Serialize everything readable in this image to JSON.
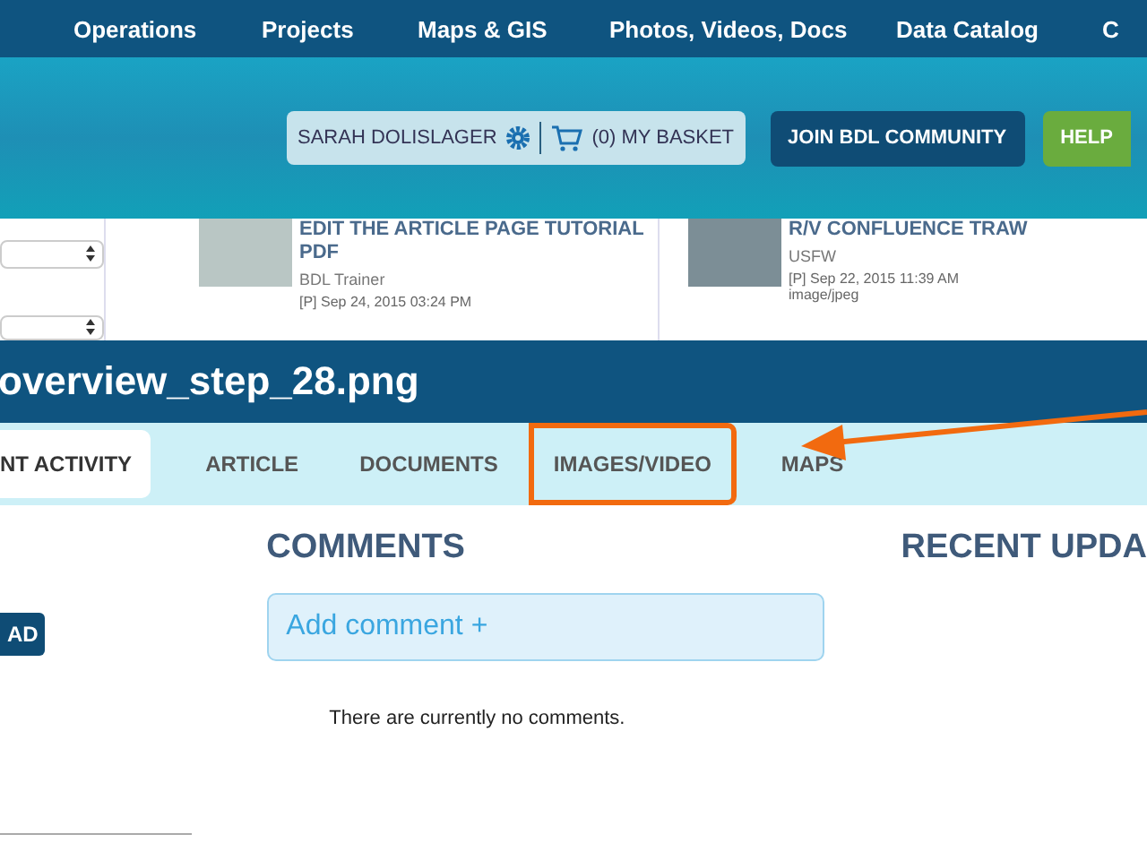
{
  "top_nav": {
    "items": [
      {
        "label": "Operations"
      },
      {
        "label": "Projects"
      },
      {
        "label": "Maps & GIS"
      },
      {
        "label": "Photos, Videos, Docs"
      },
      {
        "label": "Data Catalog"
      },
      {
        "label": "C"
      }
    ]
  },
  "user_bar": {
    "user_name": "SARAH DOLISLAGER",
    "basket": "(0) MY BASKET"
  },
  "header_buttons": [
    {
      "label": "JOIN BDL COMMUNITY",
      "kind": "primary"
    },
    {
      "label": "HELP",
      "kind": "help"
    }
  ],
  "recent_cards": [
    {
      "title": "EDIT THE ARTICLE PAGE TUTORIAL PDF",
      "author": "BDL Trainer",
      "meta": "[P] Sep 24, 2015 03:24 PM"
    },
    {
      "title": "R/V CONFLUENCE TRAW",
      "author": "USFW",
      "meta": "[P] Sep 22, 2015 11:39 AM",
      "type": "image/jpeg"
    }
  ],
  "page_title": "overview_step_28.png",
  "tabs": [
    {
      "label": "NT ACTIVITY",
      "selected": true,
      "highlighted": false
    },
    {
      "label": "ARTICLE",
      "selected": false,
      "highlighted": false
    },
    {
      "label": "DOCUMENTS",
      "selected": false,
      "highlighted": false
    },
    {
      "label": "IMAGES/VIDEO",
      "selected": false,
      "highlighted": true
    },
    {
      "label": "MAPS",
      "selected": false,
      "highlighted": false
    }
  ],
  "side_button": "AD",
  "comments": {
    "heading": "COMMENTS",
    "add_label": "Add comment +",
    "empty_text": "There are currently no comments."
  },
  "recent_updates": {
    "heading": "RECENT UPDA"
  }
}
